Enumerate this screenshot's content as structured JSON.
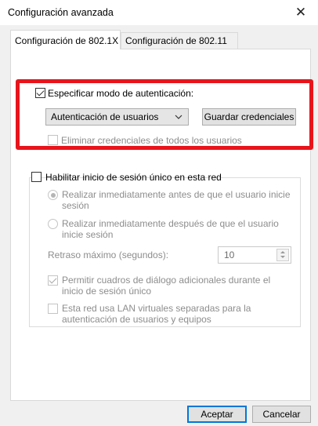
{
  "window": {
    "title": "Configuración avanzada",
    "close_glyph": "✕"
  },
  "tabs": [
    {
      "label": "Configuración de 802.1X",
      "active": true
    },
    {
      "label": "Configuración de 802.11",
      "active": false
    }
  ],
  "auth": {
    "specify_mode_label": "Especificar modo de autenticación:",
    "specify_mode_checked": true,
    "mode_selected": "Autenticación de usuarios",
    "save_credentials_label": "Guardar credenciales",
    "delete_credentials_label": "Eliminar credenciales de todos los usuarios",
    "delete_credentials_checked": false
  },
  "sso": {
    "enable_label": "Habilitar inicio de sesión único en esta red",
    "enable_checked": false,
    "radio_before_label": "Realizar inmediatamente antes de que el usuario inicie sesión",
    "radio_after_label": "Realizar inmediatamente después de que el usuario inicie sesión",
    "max_delay_label": "Retraso máximo (segundos):",
    "max_delay_value": "10",
    "allow_dialogs_label": "Permitir cuadros de diálogo adicionales durante el inicio de sesión único",
    "allow_dialogs_checked": true,
    "vlan_label": "Esta red usa LAN virtuales separadas para la autenticación de usuarios y equipos",
    "vlan_checked": false
  },
  "footer": {
    "accept_label": "Aceptar",
    "cancel_label": "Cancelar"
  },
  "colors": {
    "highlight_box": "#e8141b",
    "default_button_border": "#0078d7"
  },
  "icons": {
    "close": "close-icon",
    "dropdown": "chevron-down-icon",
    "spinner_up": "spin-up-icon",
    "spinner_down": "spin-down-icon"
  }
}
